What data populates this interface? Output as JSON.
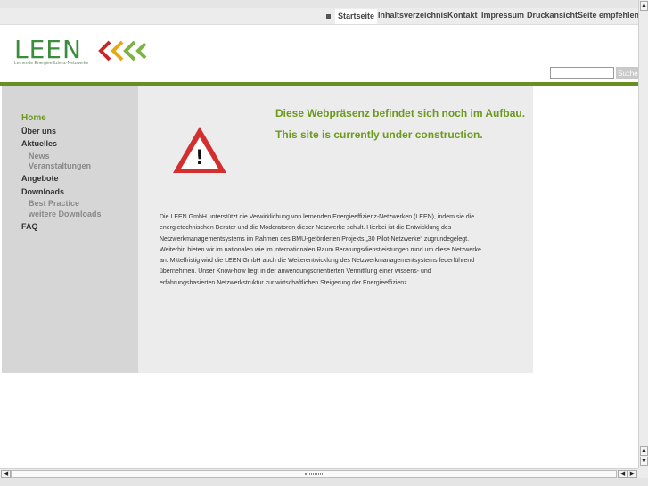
{
  "top_nav": {
    "items": [
      "Startseite",
      "Inhaltsverzeichnis",
      "Kontakt",
      "Impressum",
      "Druckansicht",
      "Seite empfehlen"
    ]
  },
  "logo": {
    "word": "LEEN",
    "tagline": "Lernende Energieeffizienz-Netzwerke",
    "chevron_colors": [
      "#c62828",
      "#e6a817",
      "#7cb342"
    ]
  },
  "search": {
    "value": "",
    "button_label": "Suche"
  },
  "sidebar": {
    "items": [
      {
        "label": "Home"
      },
      {
        "label": "Über uns"
      },
      {
        "label": "Aktuelles"
      },
      {
        "label": "News"
      },
      {
        "label": "Veranstaltungen"
      },
      {
        "label": "Angebote"
      },
      {
        "label": "Downloads"
      },
      {
        "label": "Best Practice"
      },
      {
        "label": "weitere Downloads"
      },
      {
        "label": "FAQ"
      }
    ]
  },
  "main": {
    "headline_de": "Diese Webpräsenz befindet sich noch im Aufbau.",
    "headline_en": "This site is currently under construction.",
    "warning_symbol": "!",
    "intro_lines": [
      "Die LEEN GmbH unterstützt die Verwirklichung von lernenden Energieeffizienz-Netzwerken (LEEN), indem sie die",
      "energietechnischen Berater und die Moderatoren dieser Netzwerke schult. Hierbei ist die Entwicklung des",
      "Netzwerkmanagementsystems im Rahmen des BMU-geförderten Projekts „30 Pilot-Netzwerke“ zugrundegelegt.",
      "Weiterhin bieten wir im nationalen wie im internationalen Raum Beratungsdienstleistungen rund um diese Netzwerke",
      "an. Mittelfristig wird die LEEN GmbH auch die Weiterentwicklung des Netzwerkmanagementsystems federführend",
      "übernehmen. Unser Know-how liegt in der anwendungsorientierten Vermittlung einer wissens- und",
      "erfahrungsbasierten Netzwerkstruktur zur wirtschaftlichen Steigerung der Energieeffizienz."
    ]
  },
  "colors": {
    "accent_green": "#6b9a1e",
    "bar_green": "#6b8e23",
    "warning_red": "#d32f2f"
  }
}
